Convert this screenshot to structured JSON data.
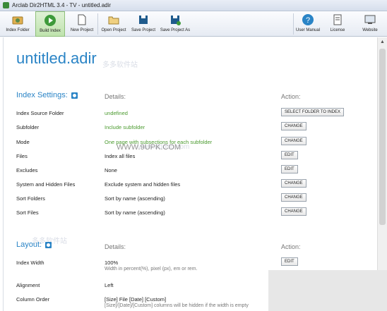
{
  "window": {
    "title": "Arclab Dir2HTML 3.4 - TV - untitled.adir"
  },
  "toolbar": {
    "index_folder": "Index Folder",
    "build_index": "Build Index",
    "new_project": "New Project",
    "open_project": "Open Project",
    "save_project": "Save Project",
    "save_project_as": "Save Project As",
    "user_manual": "User Manual",
    "license": "License",
    "website": "Website"
  },
  "document": {
    "title": "untitled.adir"
  },
  "index_settings": {
    "heading": "Index Settings:",
    "details_head": "Details:",
    "action_head": "Action:",
    "rows": [
      {
        "label": "Index Source Folder",
        "value": "undefined",
        "action": "SELECT FOLDER TO INDEX"
      },
      {
        "label": "Subfolder",
        "value": "Include subfolder",
        "action": "CHANGE"
      },
      {
        "label": "Mode",
        "value": "One page with subsections for each subfolder",
        "action": "CHANGE"
      },
      {
        "label": "Files",
        "value": "Index all files",
        "action": "EDIT"
      },
      {
        "label": "Excludes",
        "value": "None",
        "action": "EDIT"
      },
      {
        "label": "System and Hidden Files",
        "value": "Exclude system and hidden files",
        "action": "CHANGE"
      },
      {
        "label": "Sort Folders",
        "value": "Sort by name (ascending)",
        "action": "CHANGE"
      },
      {
        "label": "Sort Files",
        "value": "Sort by name (ascending)",
        "action": "CHANGE"
      }
    ]
  },
  "layout_settings": {
    "heading": "Layout:",
    "details_head": "Details:",
    "action_head": "Action:",
    "rows": [
      {
        "label": "Index Width",
        "value": "100%",
        "sub": "Width in percent(%), pixel (px), em or rem.",
        "action": "EDIT"
      },
      {
        "label": "Alignment",
        "value": "Left"
      },
      {
        "label": "Column Order",
        "value": "[Size] File [Date] [Custom]",
        "sub": "[Size]/[Date]/[Custom] columns will be hidden if the width is empty"
      }
    ]
  },
  "watermarks": [
    "多多软件站",
    "www.ddooo.com",
    "WWW.9UPK.COM"
  ],
  "colors": {
    "accent": "#2a84c6",
    "green": "#4a9a2e"
  }
}
